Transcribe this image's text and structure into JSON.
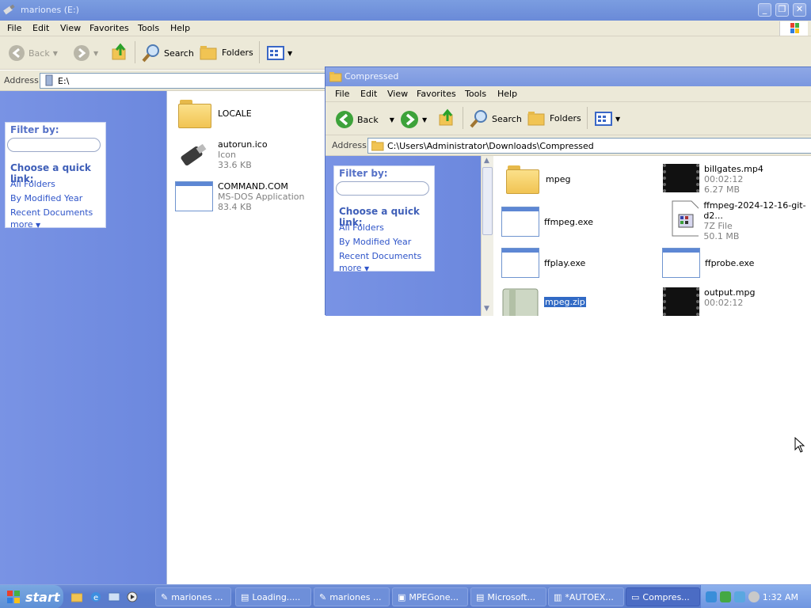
{
  "back_window": {
    "title": "mariones (E:)",
    "menu": [
      "File",
      "Edit",
      "View",
      "Favorites",
      "Tools",
      "Help"
    ],
    "toolbar": {
      "back": "Back",
      "search": "Search",
      "folders": "Folders"
    },
    "address_label": "Address",
    "address": "E:\\",
    "sidebar": {
      "filter_title": "Filter by:",
      "quick_title": "Choose a quick link:",
      "links": [
        "All Folders",
        "By Modified Year",
        "Recent Documents",
        "more"
      ]
    },
    "files": [
      {
        "name": "LOCALE",
        "type": "",
        "size": ""
      },
      {
        "name": "autorun.ico",
        "type": "Icon",
        "size": "33.6 KB"
      },
      {
        "name": "COMMAND.COM",
        "type": "MS-DOS Application",
        "size": "83.4 KB"
      }
    ]
  },
  "front_window": {
    "title": "Compressed",
    "menu": [
      "File",
      "Edit",
      "View",
      "Favorites",
      "Tools",
      "Help"
    ],
    "toolbar": {
      "back": "Back",
      "search": "Search",
      "folders": "Folders"
    },
    "address_label": "Address",
    "address": "C:\\Users\\Administrator\\Downloads\\Compressed",
    "sidebar": {
      "filter_title": "Filter by:",
      "quick_title": "Choose a quick link:",
      "links": [
        "All Folders",
        "By Modified Year",
        "Recent Documents",
        "more"
      ]
    },
    "files": [
      {
        "name": "mpeg",
        "line2": "",
        "line3": "",
        "icon": "folder-icon"
      },
      {
        "name": "billgates.mp4",
        "line2": "00:02:12",
        "line3": "6.27 MB",
        "icon": "video-icon"
      },
      {
        "name": "ffmpeg.exe",
        "line2": "",
        "line3": "",
        "icon": "exe-icon"
      },
      {
        "name": "ffmpeg-2024-12-16-git-d2...",
        "line2": "7Z File",
        "line3": "50.1 MB",
        "icon": "archive-icon"
      },
      {
        "name": "ffplay.exe",
        "line2": "",
        "line3": "",
        "icon": "exe-icon"
      },
      {
        "name": "ffprobe.exe",
        "line2": "",
        "line3": "",
        "icon": "exe-icon"
      },
      {
        "name": "mpeg.zip",
        "line2": "",
        "line3": "",
        "icon": "zip-icon"
      },
      {
        "name": "output.mpg",
        "line2": "00:02:12",
        "line3": "",
        "icon": "video-icon"
      }
    ]
  },
  "taskbar": {
    "start_label": "start",
    "buttons": [
      "mariones ...",
      "Loading.....",
      "mariones ...",
      "MPEGone...",
      "Microsoft...",
      "*AUTOEX...",
      "Compres..."
    ],
    "active_button": "Compres...",
    "clock": "1:32 AM"
  },
  "colors": {
    "sidebar_blue": "#7993e4",
    "titlebar_blue": "#7b9de0",
    "taskbar_blue": "#5a7dcf",
    "selection_blue": "#316ac5"
  }
}
